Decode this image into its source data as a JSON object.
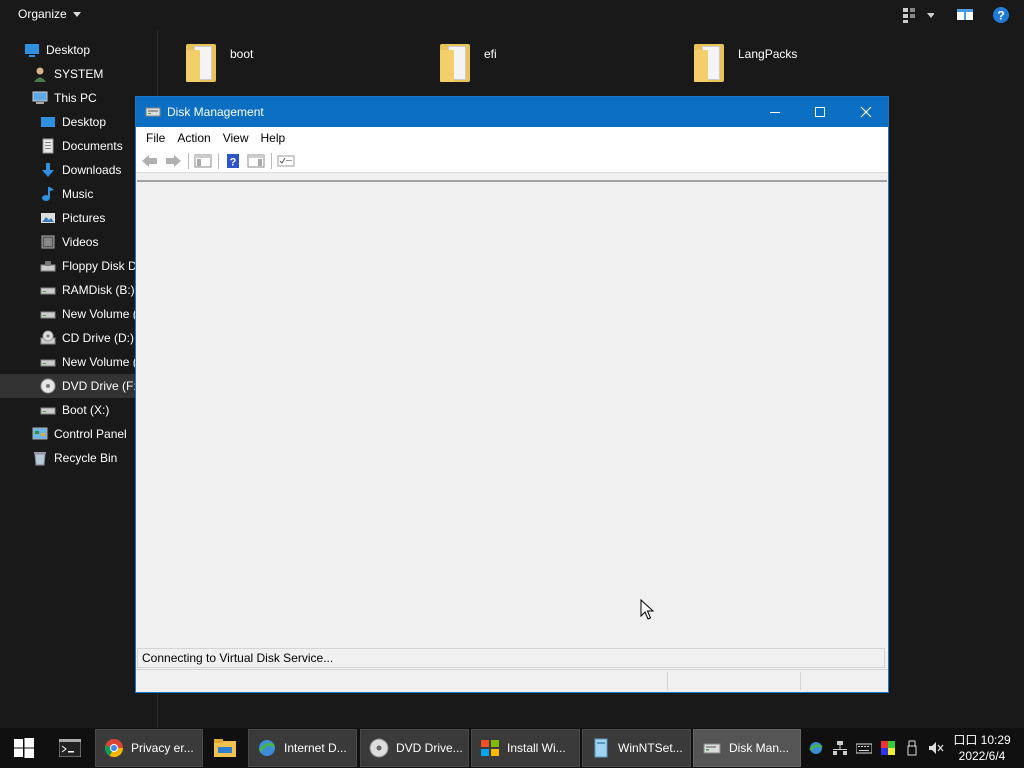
{
  "explorer": {
    "toolbar": {
      "organize_label": "Organize"
    },
    "nav": [
      {
        "label": "Desktop",
        "icon": "desktop-blue-icon"
      },
      {
        "label": "SYSTEM",
        "icon": "user-icon"
      },
      {
        "label": "This PC",
        "icon": "computer-icon"
      },
      {
        "label": "Desktop",
        "icon": "desktop-folder-icon"
      },
      {
        "label": "Documents",
        "icon": "documents-icon"
      },
      {
        "label": "Downloads",
        "icon": "downloads-icon"
      },
      {
        "label": "Music",
        "icon": "music-icon"
      },
      {
        "label": "Pictures",
        "icon": "pictures-icon"
      },
      {
        "label": "Videos",
        "icon": "videos-icon"
      },
      {
        "label": "Floppy Disk Dr",
        "icon": "floppy-drive-icon"
      },
      {
        "label": "RAMDisk (B:)",
        "icon": "drive-icon"
      },
      {
        "label": "New Volume (",
        "icon": "drive-icon"
      },
      {
        "label": "CD Drive (D:)",
        "icon": "cd-drive-icon"
      },
      {
        "label": "New Volume (",
        "icon": "drive-icon"
      },
      {
        "label": "DVD Drive (F:)",
        "icon": "dvd-drive-icon",
        "selected": true
      },
      {
        "label": "Boot (X:)",
        "icon": "drive-icon"
      },
      {
        "label": "Control Panel",
        "icon": "control-panel-icon"
      },
      {
        "label": "Recycle Bin",
        "icon": "recycle-bin-icon"
      }
    ],
    "folders": [
      {
        "name": "boot"
      },
      {
        "name": "efi"
      },
      {
        "name": "LangPacks"
      }
    ]
  },
  "disk_management": {
    "title": "Disk Management",
    "menu": [
      "File",
      "Action",
      "View",
      "Help"
    ],
    "toolbar_icons": [
      "back-arrow-icon",
      "forward-arrow-icon",
      "show-hide-console-tree-icon",
      "help-icon",
      "show-action-pane-icon",
      "properties-icon"
    ],
    "status_message": "Connecting to Virtual Disk Service..."
  },
  "taskbar": {
    "tasks": [
      {
        "label": "Privacy er...",
        "icon": "chrome-icon"
      },
      {
        "label": "Internet D...",
        "icon": "internet-download-manager-icon"
      },
      {
        "label": "DVD Drive...",
        "icon": "dvd-rom-icon"
      },
      {
        "label": "Install Wi...",
        "icon": "windows-setup-icon"
      },
      {
        "label": "WinNTSet...",
        "icon": "winntsetup-icon"
      },
      {
        "label": "Disk Man...",
        "icon": "disk-management-icon",
        "active": true
      }
    ],
    "clock": {
      "time": "口口 10:29",
      "date": "2022/6/4"
    },
    "colors": {
      "accent": "#0a6fc2",
      "background": "#191919",
      "taskbar": "#101010"
    }
  }
}
